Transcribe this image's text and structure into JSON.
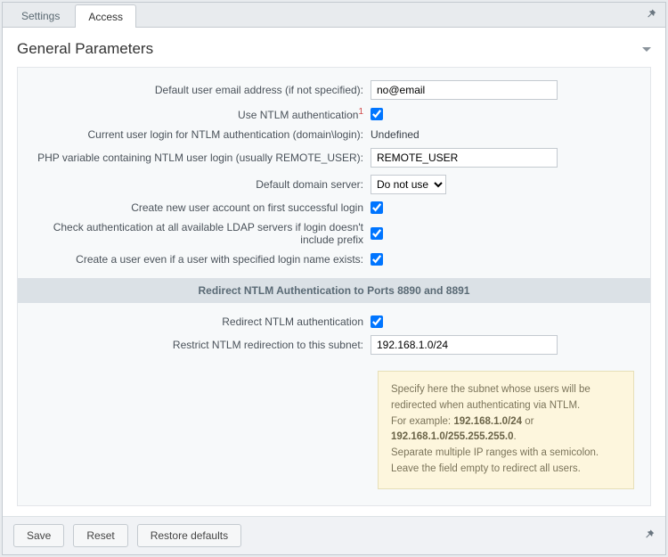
{
  "tabs": {
    "settings": "Settings",
    "access": "Access"
  },
  "panel": {
    "title": "General Parameters"
  },
  "labels": {
    "default_email": "Default user email address (if not specified):",
    "use_ntlm": "Use NTLM authentication",
    "current_login": "Current user login for NTLM authentication (domain\\login):",
    "php_var": "PHP variable containing NTLM user login (usually REMOTE_USER):",
    "default_domain": "Default domain server:",
    "create_new": "Create new user account on first successful login",
    "check_ldap": "Check authentication at all available LDAP servers if login doesn't include prefix",
    "create_even": "Create a user even if a user with specified login name exists:",
    "section_redirect": "Redirect NTLM Authentication to Ports 8890 and 8891",
    "redirect_ntlm": "Redirect NTLM authentication",
    "restrict_subnet": "Restrict NTLM redirection to this subnet:"
  },
  "values": {
    "default_email": "no@email",
    "current_login": "Undefined",
    "php_var": "REMOTE_USER",
    "default_domain_selected": "Do not use",
    "restrict_subnet": "192.168.1.0/24"
  },
  "checkboxes": {
    "use_ntlm": true,
    "create_new": true,
    "check_ldap": true,
    "create_even": true,
    "redirect_ntlm": true
  },
  "hint": {
    "line1": "Specify here the subnet whose users will be redirected when authenticating via NTLM.",
    "line2_prefix": "For example: ",
    "ex1": "192.168.1.0/24",
    "or": " or ",
    "ex2": "192.168.1.0/255.255.255.0",
    "line3": "Separate multiple IP ranges with a semicolon.",
    "line4": "Leave the field empty to redirect all users."
  },
  "buttons": {
    "save": "Save",
    "reset": "Reset",
    "restore": "Restore defaults"
  }
}
